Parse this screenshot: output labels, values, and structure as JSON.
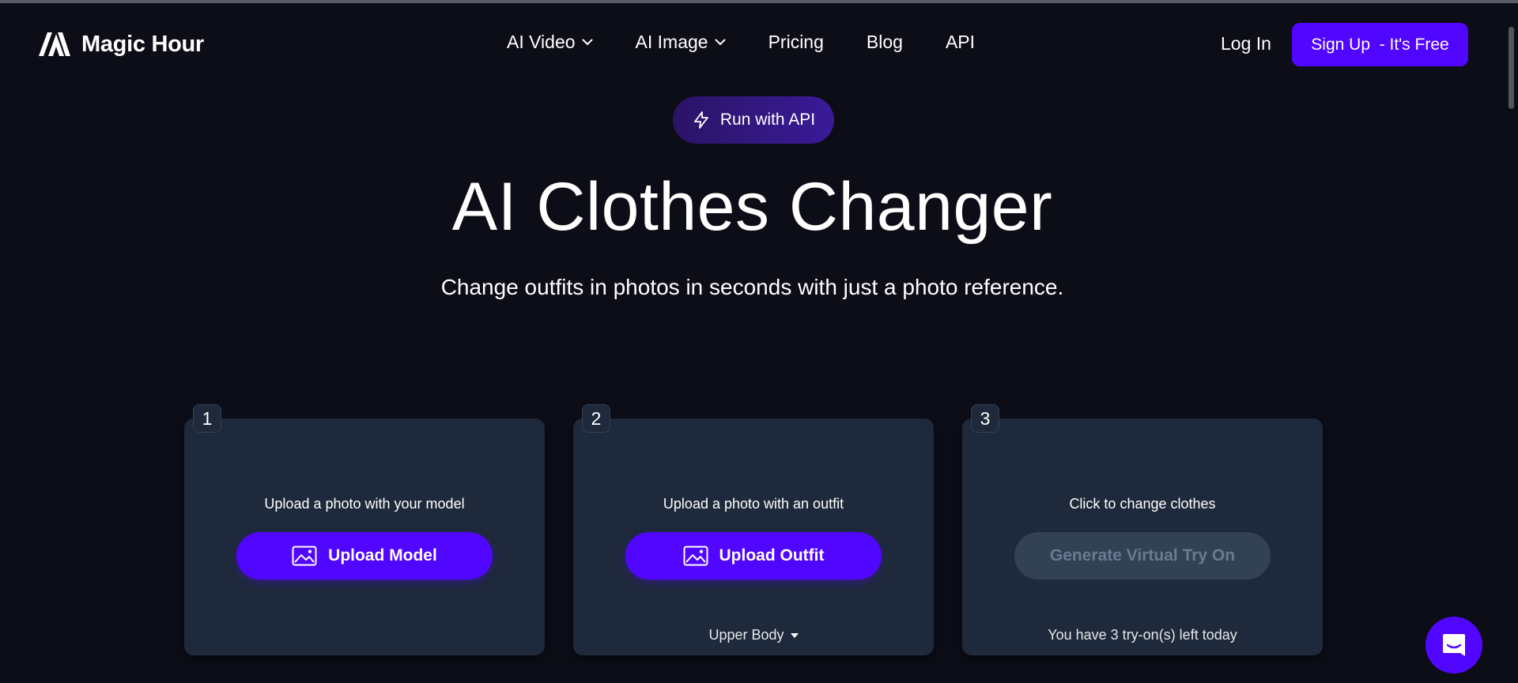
{
  "brand": {
    "name": "Magic Hour"
  },
  "nav": {
    "items": [
      {
        "label": "AI Video",
        "has_dropdown": true
      },
      {
        "label": "AI Image",
        "has_dropdown": true
      },
      {
        "label": "Pricing",
        "has_dropdown": false
      },
      {
        "label": "Blog",
        "has_dropdown": false
      },
      {
        "label": "API",
        "has_dropdown": false
      }
    ],
    "login_label": "Log In",
    "signup_label": "Sign Up  - It's Free"
  },
  "hero": {
    "api_button_label": "Run with API",
    "title": "AI Clothes Changer",
    "subtitle": "Change outfits in photos in seconds with just a photo reference."
  },
  "steps": [
    {
      "number": "1",
      "instruction": "Upload a photo with your model",
      "button_label": "Upload Model",
      "button_icon": "image-icon"
    },
    {
      "number": "2",
      "instruction": "Upload a photo with an outfit",
      "button_label": "Upload Outfit",
      "button_icon": "image-icon",
      "garment_select": "Upper Body"
    },
    {
      "number": "3",
      "instruction": "Click to change clothes",
      "button_label": "Generate Virtual Try On",
      "button_disabled": true,
      "quota_text": "You have 3 try-on(s) left today"
    }
  ],
  "chat": {
    "icon": "chat-icon"
  },
  "colors": {
    "background": "#0c0d17",
    "card": "#1e293b",
    "accent": "#5106ff",
    "disabled": "#334155"
  }
}
